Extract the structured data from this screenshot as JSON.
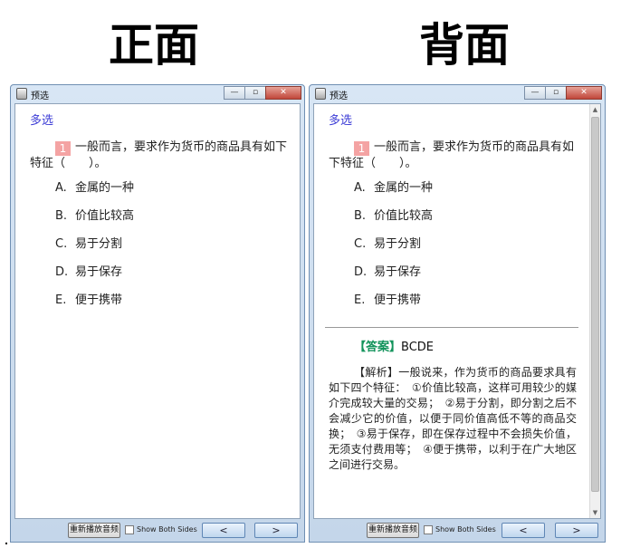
{
  "headings": {
    "front": "正面",
    "back": "背面"
  },
  "window": {
    "title": "预选",
    "min_symbol": "—",
    "max_symbol": "▫",
    "close_symbol": "✕"
  },
  "question": {
    "type": "多选",
    "number": "1",
    "text": "一般而言，要求作为货币的商品具有如下特征（　　）。",
    "options": [
      {
        "letter": "A.",
        "text": "金属的一种"
      },
      {
        "letter": "B.",
        "text": "价值比较高"
      },
      {
        "letter": "C.",
        "text": "易于分割"
      },
      {
        "letter": "D.",
        "text": "易于保存"
      },
      {
        "letter": "E.",
        "text": "便于携带"
      }
    ]
  },
  "answer": {
    "label": "【答案】",
    "value": "BCDE",
    "analysis_label": "【解析】",
    "analysis": "一般说来，作为货币的商品要求具有如下四个特征：　①价值比较高，这样可用较少的媒介完成较大量的交易；　②易于分割，即分割之后不会减少它的价值，以便于同价值高低不等的商品交换；　③易于保存，即在保存过程中不会损失价值，无须支付费用等；　④便于携带，以利于在广大地区之间进行交易。"
  },
  "toolbar": {
    "replay_label": "重新播放音频",
    "show_both_label": "Show Both Sides",
    "show_both_checked": false,
    "prev_symbol": "<",
    "next_symbol": ">"
  },
  "scrollbar": {
    "up_symbol": "▲",
    "down_symbol": "▼"
  }
}
